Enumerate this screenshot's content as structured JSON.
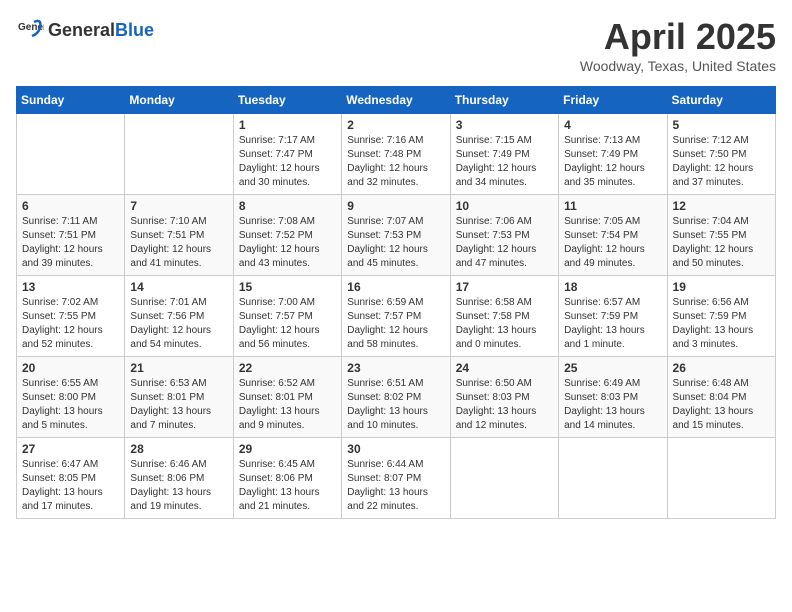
{
  "header": {
    "logo_general": "General",
    "logo_blue": "Blue",
    "title": "April 2025",
    "subtitle": "Woodway, Texas, United States"
  },
  "weekdays": [
    "Sunday",
    "Monday",
    "Tuesday",
    "Wednesday",
    "Thursday",
    "Friday",
    "Saturday"
  ],
  "weeks": [
    [
      {
        "day": "",
        "info": ""
      },
      {
        "day": "",
        "info": ""
      },
      {
        "day": "1",
        "info": "Sunrise: 7:17 AM\nSunset: 7:47 PM\nDaylight: 12 hours\nand 30 minutes."
      },
      {
        "day": "2",
        "info": "Sunrise: 7:16 AM\nSunset: 7:48 PM\nDaylight: 12 hours\nand 32 minutes."
      },
      {
        "day": "3",
        "info": "Sunrise: 7:15 AM\nSunset: 7:49 PM\nDaylight: 12 hours\nand 34 minutes."
      },
      {
        "day": "4",
        "info": "Sunrise: 7:13 AM\nSunset: 7:49 PM\nDaylight: 12 hours\nand 35 minutes."
      },
      {
        "day": "5",
        "info": "Sunrise: 7:12 AM\nSunset: 7:50 PM\nDaylight: 12 hours\nand 37 minutes."
      }
    ],
    [
      {
        "day": "6",
        "info": "Sunrise: 7:11 AM\nSunset: 7:51 PM\nDaylight: 12 hours\nand 39 minutes."
      },
      {
        "day": "7",
        "info": "Sunrise: 7:10 AM\nSunset: 7:51 PM\nDaylight: 12 hours\nand 41 minutes."
      },
      {
        "day": "8",
        "info": "Sunrise: 7:08 AM\nSunset: 7:52 PM\nDaylight: 12 hours\nand 43 minutes."
      },
      {
        "day": "9",
        "info": "Sunrise: 7:07 AM\nSunset: 7:53 PM\nDaylight: 12 hours\nand 45 minutes."
      },
      {
        "day": "10",
        "info": "Sunrise: 7:06 AM\nSunset: 7:53 PM\nDaylight: 12 hours\nand 47 minutes."
      },
      {
        "day": "11",
        "info": "Sunrise: 7:05 AM\nSunset: 7:54 PM\nDaylight: 12 hours\nand 49 minutes."
      },
      {
        "day": "12",
        "info": "Sunrise: 7:04 AM\nSunset: 7:55 PM\nDaylight: 12 hours\nand 50 minutes."
      }
    ],
    [
      {
        "day": "13",
        "info": "Sunrise: 7:02 AM\nSunset: 7:55 PM\nDaylight: 12 hours\nand 52 minutes."
      },
      {
        "day": "14",
        "info": "Sunrise: 7:01 AM\nSunset: 7:56 PM\nDaylight: 12 hours\nand 54 minutes."
      },
      {
        "day": "15",
        "info": "Sunrise: 7:00 AM\nSunset: 7:57 PM\nDaylight: 12 hours\nand 56 minutes."
      },
      {
        "day": "16",
        "info": "Sunrise: 6:59 AM\nSunset: 7:57 PM\nDaylight: 12 hours\nand 58 minutes."
      },
      {
        "day": "17",
        "info": "Sunrise: 6:58 AM\nSunset: 7:58 PM\nDaylight: 13 hours\nand 0 minutes."
      },
      {
        "day": "18",
        "info": "Sunrise: 6:57 AM\nSunset: 7:59 PM\nDaylight: 13 hours\nand 1 minute."
      },
      {
        "day": "19",
        "info": "Sunrise: 6:56 AM\nSunset: 7:59 PM\nDaylight: 13 hours\nand 3 minutes."
      }
    ],
    [
      {
        "day": "20",
        "info": "Sunrise: 6:55 AM\nSunset: 8:00 PM\nDaylight: 13 hours\nand 5 minutes."
      },
      {
        "day": "21",
        "info": "Sunrise: 6:53 AM\nSunset: 8:01 PM\nDaylight: 13 hours\nand 7 minutes."
      },
      {
        "day": "22",
        "info": "Sunrise: 6:52 AM\nSunset: 8:01 PM\nDaylight: 13 hours\nand 9 minutes."
      },
      {
        "day": "23",
        "info": "Sunrise: 6:51 AM\nSunset: 8:02 PM\nDaylight: 13 hours\nand 10 minutes."
      },
      {
        "day": "24",
        "info": "Sunrise: 6:50 AM\nSunset: 8:03 PM\nDaylight: 13 hours\nand 12 minutes."
      },
      {
        "day": "25",
        "info": "Sunrise: 6:49 AM\nSunset: 8:03 PM\nDaylight: 13 hours\nand 14 minutes."
      },
      {
        "day": "26",
        "info": "Sunrise: 6:48 AM\nSunset: 8:04 PM\nDaylight: 13 hours\nand 15 minutes."
      }
    ],
    [
      {
        "day": "27",
        "info": "Sunrise: 6:47 AM\nSunset: 8:05 PM\nDaylight: 13 hours\nand 17 minutes."
      },
      {
        "day": "28",
        "info": "Sunrise: 6:46 AM\nSunset: 8:06 PM\nDaylight: 13 hours\nand 19 minutes."
      },
      {
        "day": "29",
        "info": "Sunrise: 6:45 AM\nSunset: 8:06 PM\nDaylight: 13 hours\nand 21 minutes."
      },
      {
        "day": "30",
        "info": "Sunrise: 6:44 AM\nSunset: 8:07 PM\nDaylight: 13 hours\nand 22 minutes."
      },
      {
        "day": "",
        "info": ""
      },
      {
        "day": "",
        "info": ""
      },
      {
        "day": "",
        "info": ""
      }
    ]
  ]
}
